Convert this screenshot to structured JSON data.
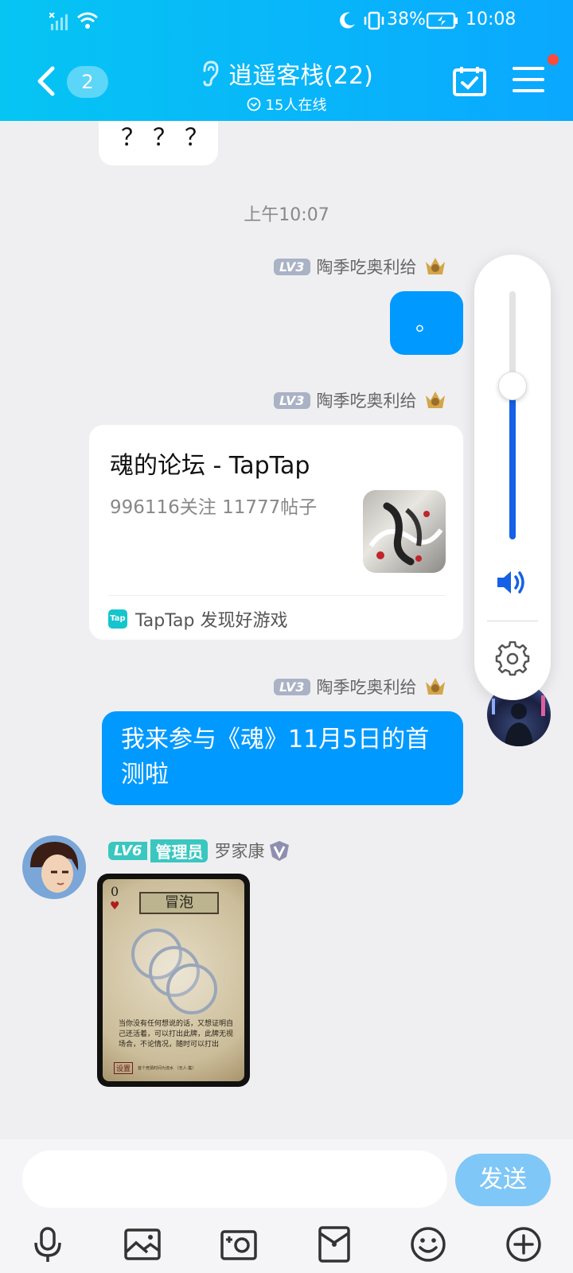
{
  "status_bar": {
    "battery": "38%",
    "time": "10:08"
  },
  "header": {
    "back_count": "2",
    "title": "逍遥客栈(22)",
    "subtitle": "15人在线",
    "icons": [
      "chevron-left-icon",
      "ear-icon",
      "calendar-check-icon",
      "menu-icon"
    ]
  },
  "chat": {
    "prev_message": "？？？",
    "timestamp": "上午10:07",
    "messages": [
      {
        "level": "LV3",
        "sender": "陶季吃奥利给",
        "text": "。"
      },
      {
        "level": "LV3",
        "sender": "陶季吃奥利给",
        "card": {
          "title": "魂的论坛 - TapTap",
          "stats": "996116关注 11777帖子",
          "source": "TapTap 发现好游戏",
          "source_icon_text": "Tap"
        }
      },
      {
        "level": "LV3",
        "sender": "陶季吃奥利给",
        "text": "我来参与《魂》11月5日的首测啦"
      },
      {
        "level": "LV6",
        "role": "管理员",
        "sender": "罗家康",
        "image": {
          "corner": "0",
          "title": "冒泡",
          "body": "当你没有任何想说的话，又想证明自己还活着，可以打出此牌，此牌无视场合，不论情况，随时可以打出",
          "tag": "设置",
          "footer": "首个竞猜时间为流水       （无人-集）"
        }
      }
    ]
  },
  "volume": {
    "level": 0.62,
    "icons": [
      "speaker-icon",
      "settings-gear-icon"
    ]
  },
  "input_bar": {
    "placeholder": "",
    "send_label": "发送",
    "tools": [
      "microphone-icon",
      "picture-icon",
      "camera-icon",
      "red-packet-icon",
      "emoji-icon",
      "plus-icon"
    ]
  },
  "colors": {
    "header_start": "#06c5f3",
    "header_end": "#0aa8ff",
    "bubble_blue": "#0099ff",
    "send_button": "#7fc7f7"
  }
}
